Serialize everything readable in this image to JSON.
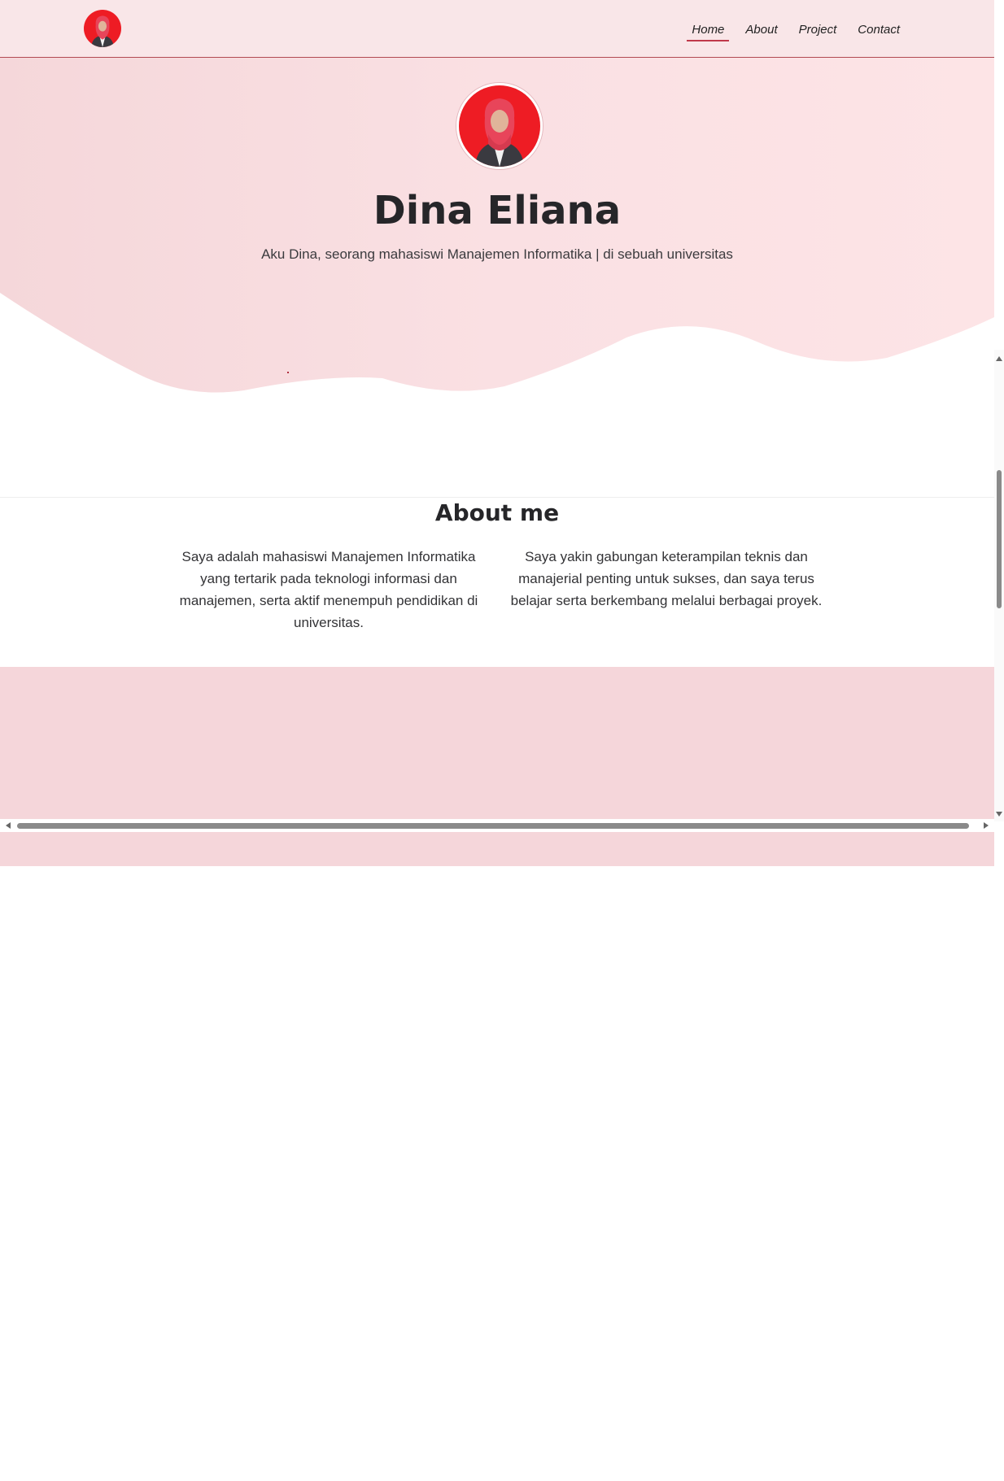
{
  "navbar": {
    "links": [
      {
        "label": "Home",
        "active": true
      },
      {
        "label": "About",
        "active": false
      },
      {
        "label": "Project",
        "active": false
      },
      {
        "label": "Contact",
        "active": false
      }
    ],
    "logo_icon": "avatar-photo"
  },
  "hero": {
    "name": "Dina Eliana",
    "tagline": "Aku Dina, seorang mahasiswi Manajemen Informatika | di sebuah universitas",
    "avatar_icon": "avatar-photo"
  },
  "about": {
    "title": "About me",
    "paragraph_left": "Saya adalah mahasiswi Manajemen Informatika yang tertarik pada teknologi informasi dan manajemen, serta aktif menempuh pendidikan di universitas.",
    "paragraph_right": "Saya yakin gabungan keterampilan teknis dan manajerial penting untuk sukses, dan saya terus belajar serta berkembang melalui berbagai proyek."
  },
  "colors": {
    "accent": "#c0394a",
    "hero_pink": "#f5d6da",
    "navbar_bg": "#f9e6e8",
    "text_dark": "#262629"
  }
}
